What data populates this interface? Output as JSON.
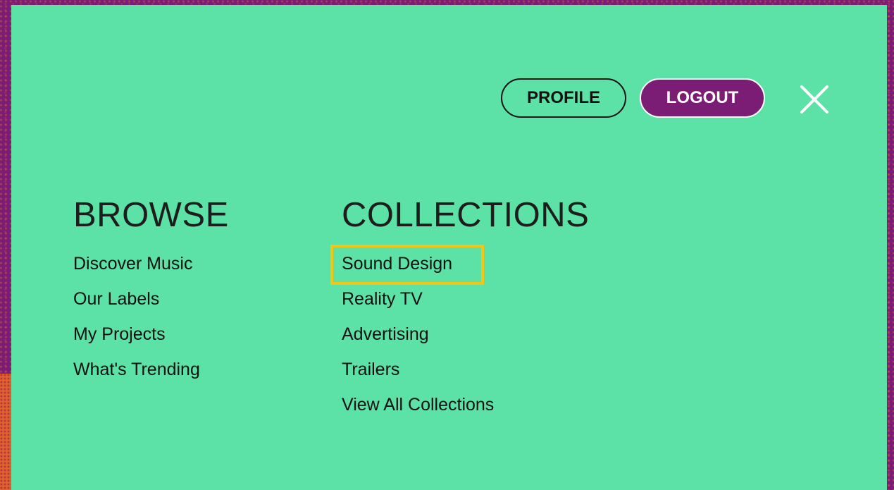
{
  "header": {
    "profile_label": "PROFILE",
    "logout_label": "LOGOUT",
    "close_icon": "close-icon"
  },
  "browse": {
    "title": "BROWSE",
    "items": [
      {
        "label": "Discover Music"
      },
      {
        "label": "Our Labels"
      },
      {
        "label": "My Projects"
      },
      {
        "label": "What's Trending"
      }
    ]
  },
  "collections": {
    "title": "COLLECTIONS",
    "items": [
      {
        "label": "Sound Design",
        "highlighted": true
      },
      {
        "label": "Reality TV"
      },
      {
        "label": "Advertising"
      },
      {
        "label": "Trailers"
      },
      {
        "label": "View All Collections"
      }
    ]
  },
  "colors": {
    "panel": "#5ce1a6",
    "brand_purple": "#7b1d74",
    "highlight": "#f3c614"
  }
}
